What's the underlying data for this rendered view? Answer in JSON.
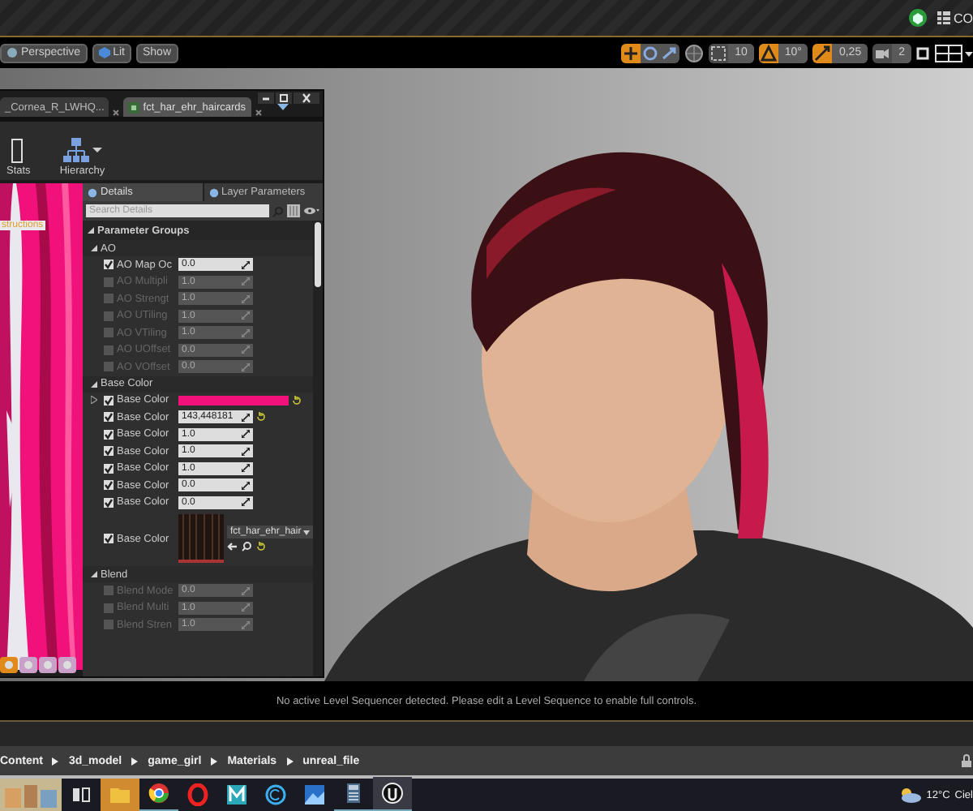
{
  "top_bar": {
    "corner_text": "CO"
  },
  "viewport_toolbar": {
    "buttons": [
      "Perspective",
      "Lit",
      "Show"
    ],
    "snaps": [
      {
        "text": "10",
        "on": false
      },
      {
        "text": "10°",
        "on": true
      },
      {
        "text": "0,25",
        "on": true
      },
      {
        "text": "2",
        "on": false
      }
    ]
  },
  "material_window": {
    "tabs": [
      {
        "label": "_Cornea_R_LWHQ...",
        "selected": false
      },
      {
        "label": "fct_har_ehr_haircards",
        "selected": true
      }
    ],
    "toolbar": [
      "Stats",
      "Hierarchy"
    ],
    "preview_note": "structions",
    "details": {
      "tabs": [
        {
          "label": "Details",
          "selected": true
        },
        {
          "label": "Layer Parameters",
          "selected": false
        }
      ],
      "search": {
        "placeholder": "Search Details"
      },
      "section": "Parameter Groups",
      "groups": [
        {
          "name": "AO",
          "rows": [
            {
              "kind": "number",
              "label": "AO Map Oc",
              "value": "0.0",
              "checked": true,
              "disabled": false
            },
            {
              "kind": "number",
              "label": "AO Multipli",
              "value": "1.0",
              "checked": false,
              "disabled": true
            },
            {
              "kind": "number",
              "label": "AO Strengt",
              "value": "1.0",
              "checked": false,
              "disabled": true
            },
            {
              "kind": "number",
              "label": "AO UTiling",
              "value": "1.0",
              "checked": false,
              "disabled": true
            },
            {
              "kind": "number",
              "label": "AO VTiling",
              "value": "1.0",
              "checked": false,
              "disabled": true
            },
            {
              "kind": "number",
              "label": "AO UOffset",
              "value": "0.0",
              "checked": false,
              "disabled": true
            },
            {
              "kind": "number",
              "label": "AO VOffset",
              "value": "0.0",
              "checked": false,
              "disabled": true
            }
          ]
        },
        {
          "name": "Base Color",
          "rows": [
            {
              "kind": "color",
              "label": "Base Color",
              "color": "#f2107a",
              "checked": true,
              "disabled": false
            },
            {
              "kind": "number",
              "label": "Base Color",
              "value": "143,448181",
              "checked": true,
              "disabled": false
            },
            {
              "kind": "number",
              "label": "Base Color",
              "value": "1.0",
              "checked": true,
              "disabled": false
            },
            {
              "kind": "number",
              "label": "Base Color",
              "value": "1.0",
              "checked": true,
              "disabled": false
            },
            {
              "kind": "number",
              "label": "Base Color",
              "value": "1.0",
              "checked": true,
              "disabled": false
            },
            {
              "kind": "number",
              "label": "Base Color",
              "value": "0.0",
              "checked": true,
              "disabled": false
            },
            {
              "kind": "number",
              "label": "Base Color",
              "value": "0.0",
              "checked": true,
              "disabled": false
            },
            {
              "kind": "texture",
              "label": "Base Color",
              "value": "fct_har_ehr_hair",
              "checked": true,
              "disabled": false
            }
          ]
        },
        {
          "name": "Blend",
          "rows": [
            {
              "kind": "number",
              "label": "Blend Mode",
              "value": "0.0",
              "checked": false,
              "disabled": true
            },
            {
              "kind": "number",
              "label": "Blend Multi",
              "value": "1.0",
              "checked": false,
              "disabled": true
            },
            {
              "kind": "number",
              "label": "Blend Stren",
              "value": "1.0",
              "checked": false,
              "disabled": true
            }
          ]
        }
      ]
    }
  },
  "status_message": "No active Level Sequencer detected. Please edit a Level Sequence to enable full controls.",
  "breadcrumb": [
    "Content",
    "3d_model",
    "game_girl",
    "Materials",
    "unreal_file"
  ],
  "taskbar": {
    "temperature": "12°C",
    "weather": "Ciel"
  }
}
